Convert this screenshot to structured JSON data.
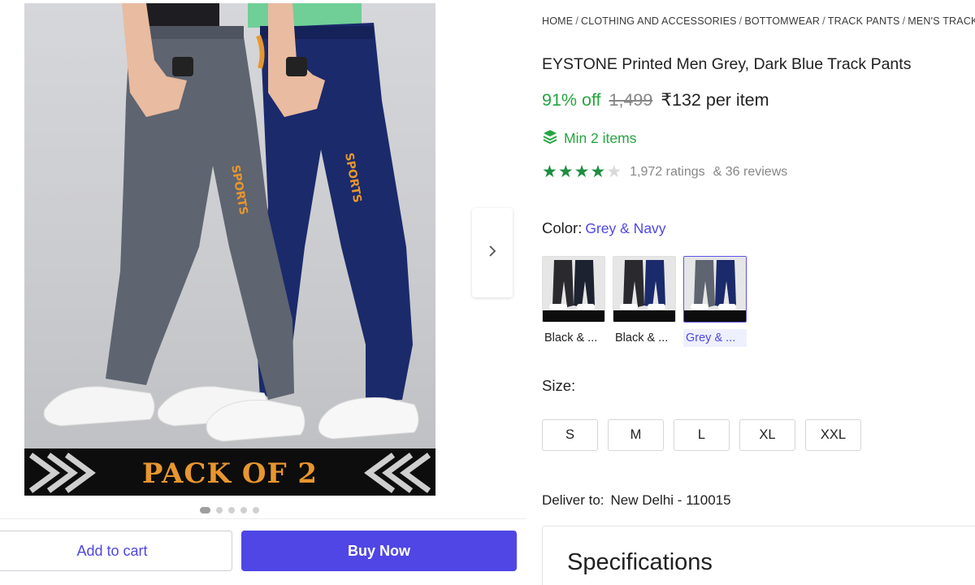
{
  "gallery": {
    "banner_text": "PACK OF 2",
    "pant_print_text": "SPORTS",
    "dot_count": 5,
    "active_dot": 0,
    "next_icon": "chevron-right-icon"
  },
  "breadcrumb": [
    "HOME",
    "CLOTHING AND ACCESSORIES",
    "BOTTOMWEAR",
    "TRACK PANTS",
    "MEN'S TRACK PANTS"
  ],
  "breadcrumb_separator": "/",
  "product": {
    "title": "EYSTONE Printed Men Grey, Dark Blue Track Pants",
    "discount": "91% off",
    "mrp": "1,499",
    "price": "₹132 per item",
    "min_items": "Min 2 items",
    "min_items_icon": "layers-icon",
    "rating_stars": 4,
    "rating_max": 5,
    "ratings_text": "1,972 ratings",
    "reviews_text": "& 36 reviews"
  },
  "color": {
    "label": "Color:",
    "selected": "Grey & Navy",
    "options": [
      {
        "label": "Black & ...",
        "colors": [
          "#2a2a2e",
          "#1d2230"
        ]
      },
      {
        "label": "Black & ...",
        "colors": [
          "#2a2a2e",
          "#1b2a6b"
        ]
      },
      {
        "label": "Grey & ...",
        "colors": [
          "#5e6470",
          "#1b2a6b"
        ]
      }
    ],
    "selected_index": 2
  },
  "size": {
    "label": "Size:",
    "options": [
      "S",
      "M",
      "L",
      "XL",
      "XXL"
    ]
  },
  "delivery": {
    "label": "Deliver to:",
    "location": "New Delhi - 110015"
  },
  "specifications_title": "Specifications",
  "actions": {
    "add_to_cart": "Add to cart",
    "buy_now": "Buy Now"
  },
  "colors": {
    "accent": "#4f46e5",
    "discount_green": "#26a541",
    "star_green": "#1e8e3e",
    "pant_grey": "#5e6470",
    "pant_navy": "#1b2a6b",
    "print_orange": "#e8962e"
  }
}
